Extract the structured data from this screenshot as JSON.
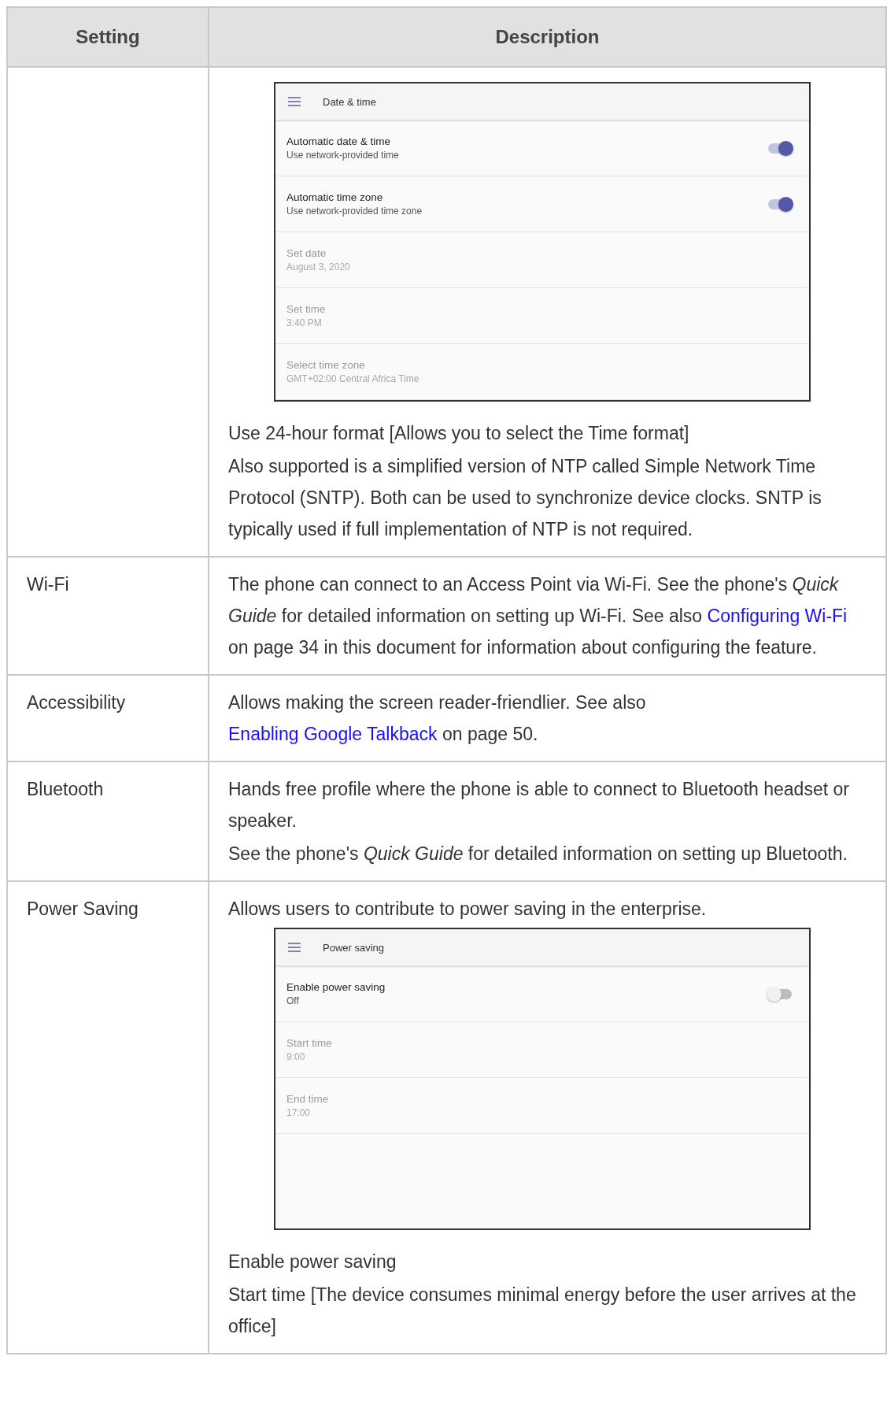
{
  "table": {
    "columns": [
      "Setting",
      "Description"
    ],
    "rows": [
      {
        "setting": "",
        "description": [
          {
            "kind": "screenshot",
            "title": "Date & time",
            "items": [
              {
                "kind": "toggle",
                "label": "Automatic date & time",
                "value": "Use network-provided time",
                "on": true,
                "disabled": false
              },
              {
                "kind": "toggle",
                "label": "Automatic time zone",
                "value": "Use network-provided time zone",
                "on": true,
                "disabled": false
              },
              {
                "kind": "value",
                "label": "Set date",
                "value": "August 3, 2020",
                "disabled": true
              },
              {
                "kind": "value",
                "label": "Set time",
                "value": "3:40 PM",
                "disabled": true
              },
              {
                "kind": "value",
                "label": "Select time zone",
                "value": "GMT+02:00 Central Africa Time",
                "disabled": true
              }
            ]
          },
          {
            "kind": "paragraph",
            "parts": [
              {
                "kind": "text",
                "text": "Use 24-hour format [Allows you to select the Time format]"
              }
            ]
          },
          {
            "kind": "paragraph",
            "parts": [
              {
                "kind": "text",
                "text": "Also supported is a simplified version of NTP called Simple Network Time Protocol (SNTP). Both can be used to synchronize device clocks. SNTP is typically used if full implementation of NTP is not required."
              }
            ]
          }
        ]
      },
      {
        "setting": "Wi-Fi",
        "description": [
          {
            "kind": "paragraph",
            "parts": [
              {
                "kind": "text",
                "text": "The phone can connect to an Access Point via Wi-Fi. See the phone's "
              },
              {
                "kind": "italic",
                "text": "Quick Guide"
              },
              {
                "kind": "text",
                "text": " for detailed information on setting up Wi-Fi. See also "
              },
              {
                "kind": "link",
                "text": "Configuring Wi-Fi"
              },
              {
                "kind": "text",
                "text": " on page 34 in this document for information about configuring the feature."
              }
            ]
          }
        ]
      },
      {
        "setting": "Accessibility",
        "description": [
          {
            "kind": "paragraph",
            "parts": [
              {
                "kind": "text",
                "text": "Allows making the screen reader-friendlier. See also "
              },
              {
                "kind": "link",
                "text": "Enabling Google Talkback"
              },
              {
                "kind": "text",
                "text": " on page 50."
              }
            ]
          }
        ]
      },
      {
        "setting": "Bluetooth",
        "description": [
          {
            "kind": "paragraph",
            "parts": [
              {
                "kind": "text",
                "text": "Hands free profile where the phone is able to connect to Bluetooth headset or speaker."
              }
            ]
          },
          {
            "kind": "paragraph",
            "parts": [
              {
                "kind": "text",
                "text": "See the phone's "
              },
              {
                "kind": "italic",
                "text": "Quick Guide"
              },
              {
                "kind": "text",
                "text": " for detailed information on setting up Bluetooth."
              }
            ]
          }
        ]
      },
      {
        "setting": "Power Saving",
        "description": [
          {
            "kind": "paragraph",
            "parts": [
              {
                "kind": "text",
                "text": "Allows users to contribute to power saving in the enterprise."
              }
            ]
          },
          {
            "kind": "screenshot",
            "title": "Power saving",
            "items": [
              {
                "kind": "toggle",
                "label": "Enable power saving",
                "value": "Off",
                "on": false,
                "disabled": false
              },
              {
                "kind": "value",
                "label": "Start time",
                "value": "9:00",
                "disabled": true
              },
              {
                "kind": "value",
                "label": "End time",
                "value": "17:00",
                "disabled": true
              }
            ]
          },
          {
            "kind": "paragraph",
            "parts": [
              {
                "kind": "text",
                "text": "Enable power saving"
              }
            ]
          },
          {
            "kind": "paragraph",
            "parts": [
              {
                "kind": "text",
                "text": "Start time [The device consumes minimal energy before the user arrives at the office]"
              }
            ]
          }
        ]
      }
    ]
  }
}
